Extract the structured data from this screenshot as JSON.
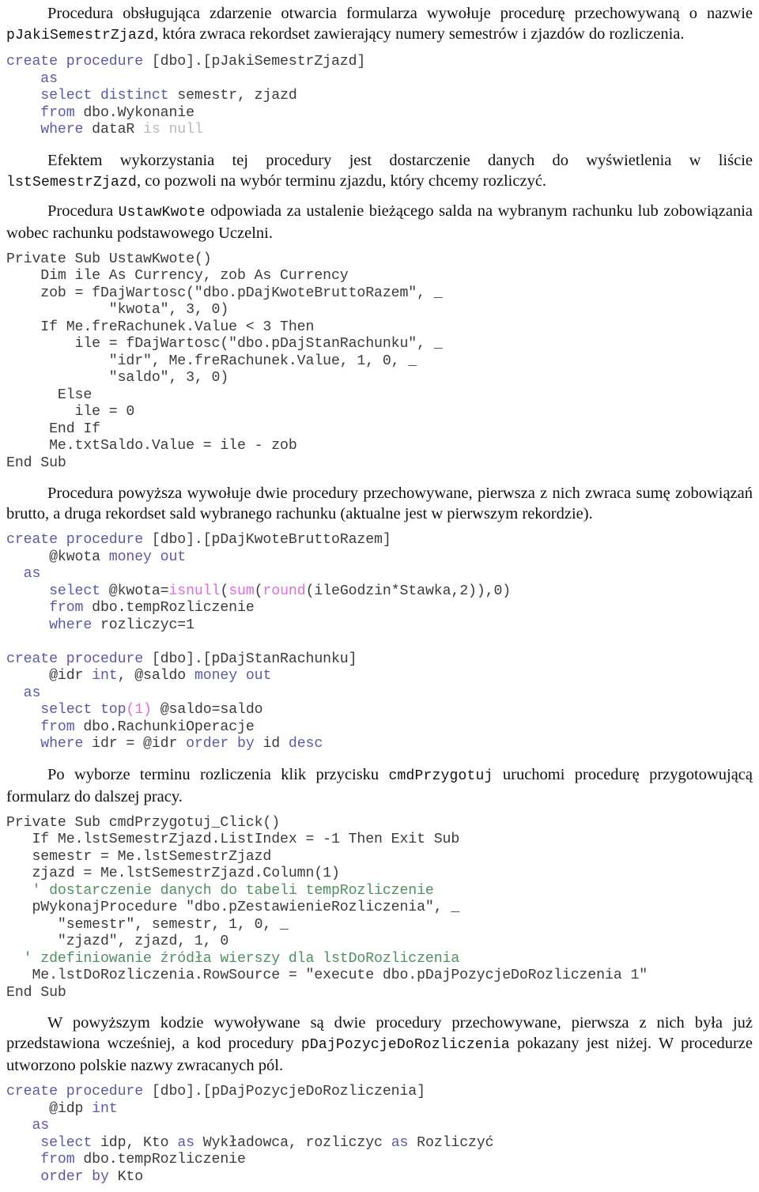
{
  "document": {
    "language": "pl",
    "colors": {
      "sql_keyword": "#5a5aa8",
      "sql_function": "#d96fd9",
      "null_literal": "#b9b9b9",
      "vba_comment": "#4f8f60",
      "code_default": "#3b3b3b",
      "body_text": "#111111",
      "background": "#ffffff"
    },
    "blocks": [
      {
        "id": "para-1",
        "type": "paragraph",
        "runs": [
          {
            "text": "Procedura obsługująca zdarzenie otwarcia formularza wywołuje procedurę przechowywaną o nazwie ",
            "style": "serif"
          },
          {
            "text": "pJakiSemestrZjazd",
            "style": "mono"
          },
          {
            "text": ", która zwraca rekordset zawierający numery semestrów i zjazdów do rozliczenia.",
            "style": "serif"
          }
        ]
      },
      {
        "id": "code-1",
        "type": "code",
        "lines": [
          [
            {
              "t": "create procedure",
              "c": "kw"
            },
            {
              "t": " [dbo].[pJakiSemestrZjazd]",
              "c": "id"
            }
          ],
          [
            {
              "t": "    ",
              "c": "id"
            },
            {
              "t": "as",
              "c": "kw"
            }
          ],
          [
            {
              "t": "    ",
              "c": "id"
            },
            {
              "t": "select distinct",
              "c": "kw"
            },
            {
              "t": " semestr, zjazd",
              "c": "id"
            }
          ],
          [
            {
              "t": "    ",
              "c": "id"
            },
            {
              "t": "from",
              "c": "kw"
            },
            {
              "t": " dbo.Wykonanie",
              "c": "id"
            }
          ],
          [
            {
              "t": "    ",
              "c": "id"
            },
            {
              "t": "where",
              "c": "kw"
            },
            {
              "t": " dataR ",
              "c": "id"
            },
            {
              "t": "is null",
              "c": "nul"
            }
          ]
        ]
      },
      {
        "id": "para-2",
        "type": "paragraph",
        "runs": [
          {
            "text": "Efektem wykorzystania tej procedury jest dostarczenie danych do wyświetlenia w liście ",
            "style": "serif"
          },
          {
            "text": "lstSemestrZjazd",
            "style": "mono"
          },
          {
            "text": ", co pozwoli na wybór terminu zjazdu, który chcemy rozliczyć.",
            "style": "serif"
          }
        ]
      },
      {
        "id": "para-3",
        "type": "paragraph",
        "runs": [
          {
            "text": "Procedura ",
            "style": "serif"
          },
          {
            "text": "UstawKwote",
            "style": "mono"
          },
          {
            "text": " odpowiada za ustalenie bieżącego salda na wybranym rachunku lub zobowiązania wobec rachunku podstawowego Uczelni.",
            "style": "serif"
          }
        ]
      },
      {
        "id": "code-2",
        "type": "code",
        "lines": [
          [
            {
              "t": "Private Sub UstawKwote()",
              "c": "vba"
            }
          ],
          [
            {
              "t": "    Dim ile As Currency, zob As Currency",
              "c": "vba"
            }
          ],
          [
            {
              "t": "    zob = fDajWartosc(\"dbo.pDajKwoteBruttoRazem\", _",
              "c": "vba"
            }
          ],
          [
            {
              "t": "            \"kwota\", 3, 0)",
              "c": "vba"
            }
          ],
          [
            {
              "t": "    If Me.freRachunek.Value < 3 Then",
              "c": "vba"
            }
          ],
          [
            {
              "t": "        ile = fDajWartosc(\"dbo.pDajStanRachunku\", _",
              "c": "vba"
            }
          ],
          [
            {
              "t": "            \"idr\", Me.freRachunek.Value, 1, 0, _",
              "c": "vba"
            }
          ],
          [
            {
              "t": "            \"saldo\", 3, 0)",
              "c": "vba"
            }
          ],
          [
            {
              "t": "      Else",
              "c": "vba"
            }
          ],
          [
            {
              "t": "        ile = 0",
              "c": "vba"
            }
          ],
          [
            {
              "t": "     End If",
              "c": "vba"
            }
          ],
          [
            {
              "t": "     Me.txtSaldo.Value = ile - zob",
              "c": "vba"
            }
          ],
          [
            {
              "t": "End Sub",
              "c": "vba"
            }
          ]
        ]
      },
      {
        "id": "para-4",
        "type": "paragraph",
        "runs": [
          {
            "text": "Procedura powyższa wywołuje dwie procedury przechowywane, pierwsza z nich zwraca sumę zobowiązań brutto, a druga rekordset sald wybranego rachunku (aktualne jest w pierwszym rekordzie).",
            "style": "serif"
          }
        ]
      },
      {
        "id": "code-3",
        "type": "code",
        "lines": [
          [
            {
              "t": "create procedure",
              "c": "kw"
            },
            {
              "t": " [dbo].[pDajKwoteBruttoRazem]",
              "c": "id"
            }
          ],
          [
            {
              "t": "     @kwota ",
              "c": "id"
            },
            {
              "t": "money out",
              "c": "kw"
            }
          ],
          [
            {
              "t": "  ",
              "c": "id"
            },
            {
              "t": "as",
              "c": "kw"
            }
          ],
          [
            {
              "t": "     ",
              "c": "id"
            },
            {
              "t": "select",
              "c": "kw"
            },
            {
              "t": " @kwota=",
              "c": "id"
            },
            {
              "t": "isnull",
              "c": "fn"
            },
            {
              "t": "(",
              "c": "id"
            },
            {
              "t": "sum",
              "c": "fn"
            },
            {
              "t": "(",
              "c": "id"
            },
            {
              "t": "round",
              "c": "fn"
            },
            {
              "t": "(ileGodzin*Stawka,2)),0)",
              "c": "id"
            }
          ],
          [
            {
              "t": "     ",
              "c": "id"
            },
            {
              "t": "from",
              "c": "kw"
            },
            {
              "t": " dbo.tempRozliczenie",
              "c": "id"
            }
          ],
          [
            {
              "t": "     ",
              "c": "id"
            },
            {
              "t": "where",
              "c": "kw"
            },
            {
              "t": " rozliczyc=1",
              "c": "id"
            }
          ],
          [
            {
              "t": "",
              "c": "id"
            }
          ],
          [
            {
              "t": "create procedure",
              "c": "kw"
            },
            {
              "t": " [dbo].[pDajStanRachunku]",
              "c": "id"
            }
          ],
          [
            {
              "t": "     @idr ",
              "c": "id"
            },
            {
              "t": "int",
              "c": "kw"
            },
            {
              "t": ", @saldo ",
              "c": "id"
            },
            {
              "t": "money out",
              "c": "kw"
            }
          ],
          [
            {
              "t": "  ",
              "c": "id"
            },
            {
              "t": "as",
              "c": "kw"
            }
          ],
          [
            {
              "t": "    ",
              "c": "id"
            },
            {
              "t": "select top",
              "c": "kw"
            },
            {
              "t": "(1)",
              "c": "fn"
            },
            {
              "t": " @saldo=saldo",
              "c": "id"
            }
          ],
          [
            {
              "t": "    ",
              "c": "id"
            },
            {
              "t": "from",
              "c": "kw"
            },
            {
              "t": " dbo.RachunkiOperacje",
              "c": "id"
            }
          ],
          [
            {
              "t": "    ",
              "c": "id"
            },
            {
              "t": "where",
              "c": "kw"
            },
            {
              "t": " idr = @idr ",
              "c": "id"
            },
            {
              "t": "order by",
              "c": "kw"
            },
            {
              "t": " id ",
              "c": "id"
            },
            {
              "t": "desc",
              "c": "kw"
            }
          ]
        ]
      },
      {
        "id": "para-5",
        "type": "paragraph",
        "runs": [
          {
            "text": "Po wyborze terminu rozliczenia klik przycisku ",
            "style": "serif"
          },
          {
            "text": "cmdPrzygotuj",
            "style": "mono"
          },
          {
            "text": " uruchomi procedurę przygotowującą formularz do dalszej pracy.",
            "style": "serif"
          }
        ]
      },
      {
        "id": "code-4",
        "type": "code",
        "lines": [
          [
            {
              "t": "Private Sub cmdPrzygotuj_Click()",
              "c": "vba"
            }
          ],
          [
            {
              "t": "   If Me.lstSemestrZjazd.ListIndex = -1 Then Exit Sub",
              "c": "vba"
            }
          ],
          [
            {
              "t": "   semestr = Me.lstSemestrZjazd",
              "c": "vba"
            }
          ],
          [
            {
              "t": "   zjazd = Me.lstSemestrZjazd.Column(1)",
              "c": "vba"
            }
          ],
          [
            {
              "t": "   ' dostarczenie danych do tabeli tempRozliczenie",
              "c": "cmt"
            }
          ],
          [
            {
              "t": "   pWykonajProcedure \"dbo.pZestawienieRozliczenia\", _",
              "c": "vba"
            }
          ],
          [
            {
              "t": "      \"semestr\", semestr, 1, 0, _",
              "c": "vba"
            }
          ],
          [
            {
              "t": "      \"zjazd\", zjazd, 1, 0",
              "c": "vba"
            }
          ],
          [
            {
              "t": "  ' zdefiniowanie źródła wierszy dla lstDoRozliczenia",
              "c": "cmt"
            }
          ],
          [
            {
              "t": "   Me.lstDoRozliczenia.RowSource = \"execute dbo.pDajPozycjeDoRozliczenia 1\"",
              "c": "vba"
            }
          ],
          [
            {
              "t": "End Sub",
              "c": "vba"
            }
          ]
        ]
      },
      {
        "id": "para-6",
        "type": "paragraph",
        "runs": [
          {
            "text": "W powyższym kodzie wywoływane są dwie procedury przechowywane, pierwsza z nich była już przedstawiona wcześniej, a kod procedury ",
            "style": "serif"
          },
          {
            "text": "pDajPozycjeDoRozliczenia",
            "style": "mono"
          },
          {
            "text": " pokazany jest niżej. W procedurze utworzono polskie nazwy zwracanych pól.",
            "style": "serif"
          }
        ]
      },
      {
        "id": "code-5",
        "type": "code",
        "lines": [
          [
            {
              "t": "create procedure",
              "c": "kw"
            },
            {
              "t": " [dbo].[pDajPozycjeDoRozliczenia]",
              "c": "id"
            }
          ],
          [
            {
              "t": "     @idp ",
              "c": "id"
            },
            {
              "t": "int",
              "c": "kw"
            }
          ],
          [
            {
              "t": "   ",
              "c": "id"
            },
            {
              "t": "as",
              "c": "kw"
            }
          ],
          [
            {
              "t": "    ",
              "c": "id"
            },
            {
              "t": "select",
              "c": "kw"
            },
            {
              "t": " idp, Kto ",
              "c": "id"
            },
            {
              "t": "as",
              "c": "kw"
            },
            {
              "t": " Wykładowca, rozliczyc ",
              "c": "id"
            },
            {
              "t": "as",
              "c": "kw"
            },
            {
              "t": " Rozliczyć",
              "c": "id"
            }
          ],
          [
            {
              "t": "    ",
              "c": "id"
            },
            {
              "t": "from",
              "c": "kw"
            },
            {
              "t": " dbo.tempRozliczenie",
              "c": "id"
            }
          ],
          [
            {
              "t": "    ",
              "c": "id"
            },
            {
              "t": "order by",
              "c": "kw"
            },
            {
              "t": " Kto",
              "c": "id"
            }
          ]
        ]
      }
    ]
  }
}
